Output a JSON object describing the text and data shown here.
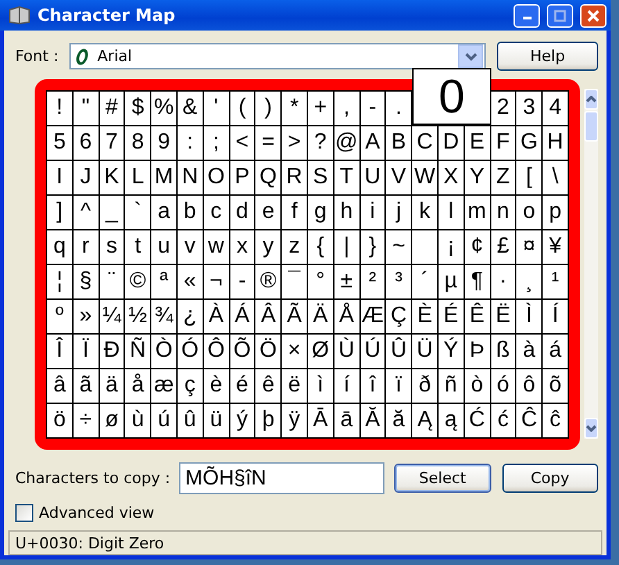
{
  "window": {
    "title": "Character Map"
  },
  "font": {
    "label": "Font :",
    "value": "Arial"
  },
  "help_button": "Help",
  "grid": {
    "rows": [
      [
        "!",
        "\"",
        "#",
        "$",
        "%",
        "&",
        "'",
        "(",
        ")",
        "*",
        "+",
        ",",
        "-",
        ".",
        null,
        null,
        null,
        "2",
        "3",
        "4"
      ],
      [
        "5",
        "6",
        "7",
        "8",
        "9",
        ":",
        ";",
        "<",
        "=",
        ">",
        "?",
        "@",
        "A",
        "B",
        "C",
        "D",
        "E",
        "F",
        "G",
        "H"
      ],
      [
        "I",
        "J",
        "K",
        "L",
        "M",
        "N",
        "O",
        "P",
        "Q",
        "R",
        "S",
        "T",
        "U",
        "V",
        "W",
        "X",
        "Y",
        "Z",
        "[",
        "\\"
      ],
      [
        "]",
        "^",
        "_",
        "`",
        "a",
        "b",
        "c",
        "d",
        "e",
        "f",
        "g",
        "h",
        "i",
        "j",
        "k",
        "l",
        "m",
        "n",
        "o",
        "p"
      ],
      [
        "q",
        "r",
        "s",
        "t",
        "u",
        "v",
        "w",
        "x",
        "y",
        "z",
        "{",
        "|",
        "}",
        "~",
        {
          "kind": "blank"
        },
        "¡",
        "¢",
        "£",
        "¤",
        "¥"
      ],
      [
        "¦",
        "§",
        "¨",
        "©",
        "ª",
        "«",
        "¬",
        "-",
        "®",
        "¯",
        "°",
        "±",
        "²",
        "³",
        "´",
        "µ",
        "¶",
        "·",
        "¸",
        "¹"
      ],
      [
        "º",
        "»",
        "¼",
        "½",
        "¾",
        "¿",
        "À",
        "Á",
        "Â",
        "Ã",
        "Ä",
        "Å",
        "Æ",
        "Ç",
        "È",
        "É",
        "Ê",
        "Ë",
        "Ì",
        "Í"
      ],
      [
        "Î",
        "Ï",
        "Ð",
        "Ñ",
        "Ò",
        "Ó",
        "Ô",
        "Õ",
        "Ö",
        "×",
        "Ø",
        "Ù",
        "Ú",
        "Û",
        "Ü",
        "Ý",
        "Þ",
        "ß",
        "à",
        "á"
      ],
      [
        "â",
        "ã",
        "ä",
        "å",
        "æ",
        "ç",
        "è",
        "é",
        "ê",
        "ë",
        "ì",
        "í",
        "î",
        "ï",
        "ð",
        "ñ",
        "ò",
        "ó",
        "ô",
        "õ"
      ],
      [
        "ö",
        "÷",
        "ø",
        "ù",
        "ú",
        "û",
        "ü",
        "ý",
        "þ",
        "ÿ",
        "Ā",
        "ā",
        "Ă",
        "ă",
        "Ą",
        "ą",
        "Ć",
        "ć",
        "Ĉ",
        "ĉ"
      ]
    ]
  },
  "magnified": "0",
  "copy": {
    "label": "Characters to copy :",
    "value": "MÕH§îN"
  },
  "buttons": [
    "Select",
    "Copy"
  ],
  "advanced_view": {
    "label": "Advanced view",
    "checked": false
  },
  "status_bar": "U+0030: Digit Zero"
}
